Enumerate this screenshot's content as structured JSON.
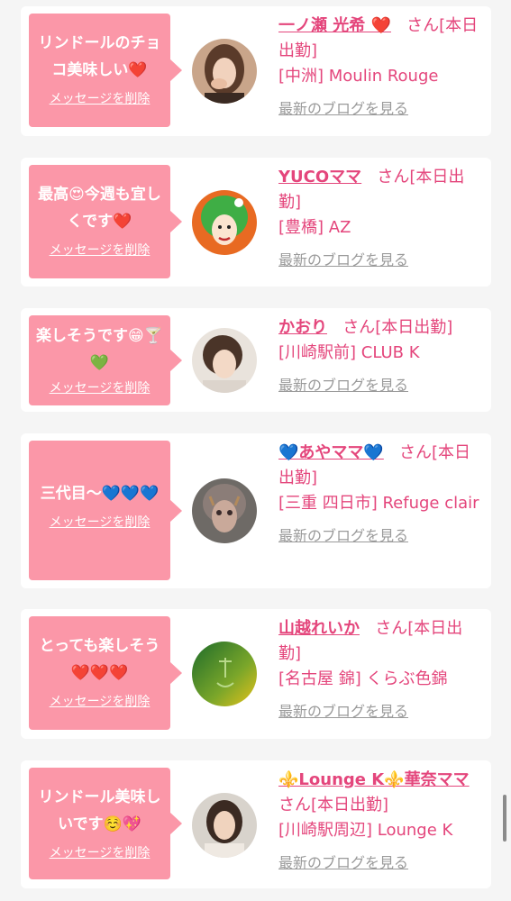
{
  "delete_label": "メッセージを削除",
  "blog_label": "最新のブログを見る",
  "san_label": "さん",
  "cards": [
    {
      "message": "リンドールのチョコ美味しい❤️",
      "name": "一ノ瀬 光希 ❤️",
      "status": "[本日出勤]",
      "shop": "[中洲] Moulin Rouge",
      "avatar": "portrait-photo-1"
    },
    {
      "message": "最高😍今週も宜しくです❤️",
      "name": "YUCOママ",
      "status": "[本日出勤]",
      "shop": "[豊橋] AZ",
      "avatar": "green-hair-illustration"
    },
    {
      "message": "楽しそうです😁🍸💚",
      "name": "かおり",
      "status": "[本日出勤]",
      "shop": "[川崎駅前] CLUB K",
      "avatar": "portrait-photo-2"
    },
    {
      "message": "三代目〜💙💙💙",
      "name": "💙あやママ💙",
      "status": "[本日出勤]",
      "shop": "[三重 四日市] Refuge clair",
      "avatar": "portrait-photo-3"
    },
    {
      "message": "とっても楽しそう❤️❤️❤️",
      "name": "山越れいか",
      "status": "[本日出勤]",
      "shop": "[名古屋 錦] くらぶ色錦",
      "avatar": "green-logo"
    },
    {
      "message": "リンドール美味しいです☺️💖",
      "name": "⚜️Lounge K⚜️華奈ママ",
      "status": "[本日出勤]",
      "shop": "[川崎駅周辺] Lounge K",
      "avatar": "portrait-photo-4"
    }
  ]
}
